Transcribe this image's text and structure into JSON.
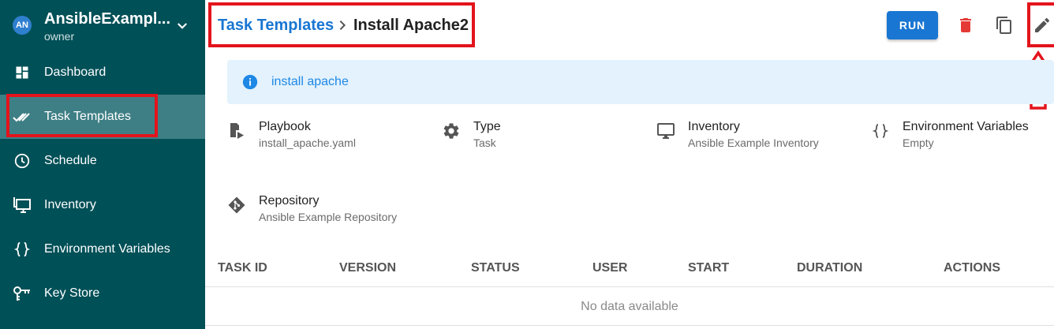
{
  "project": {
    "initials": "AN",
    "name": "AnsibleExampl...",
    "role": "owner"
  },
  "sidebar": {
    "items": [
      {
        "label": "Dashboard",
        "icon": "dashboard-icon"
      },
      {
        "label": "Task Templates",
        "icon": "task-templates-icon",
        "active": true
      },
      {
        "label": "Schedule",
        "icon": "clock-icon"
      },
      {
        "label": "Inventory",
        "icon": "monitor-icon"
      },
      {
        "label": "Environment Variables",
        "icon": "braces-icon"
      },
      {
        "label": "Key Store",
        "icon": "key-icon"
      }
    ]
  },
  "header": {
    "breadcrumb_parent": "Task Templates",
    "title": "Install Apache2",
    "run_label": "RUN"
  },
  "alert": {
    "text": "install apache"
  },
  "details": {
    "playbook": {
      "title": "Playbook",
      "value": "install_apache.yaml"
    },
    "type": {
      "title": "Type",
      "value": "Task"
    },
    "inventory": {
      "title": "Inventory",
      "value": "Ansible Example Inventory"
    },
    "environment": {
      "title": "Environment Variables",
      "value": "Empty"
    },
    "repository": {
      "title": "Repository",
      "value": "Ansible Example Repository"
    }
  },
  "table": {
    "columns": [
      "TASK ID",
      "VERSION",
      "STATUS",
      "USER",
      "START",
      "DURATION",
      "ACTIONS"
    ],
    "empty_text": "No data available"
  },
  "colors": {
    "sidebar_bg": "#005057",
    "sidebar_active": "#3e7f85",
    "primary": "#1976d2",
    "danger": "#e53935",
    "annotation": "#e3141c",
    "alert_bg": "#e3f2fd"
  }
}
